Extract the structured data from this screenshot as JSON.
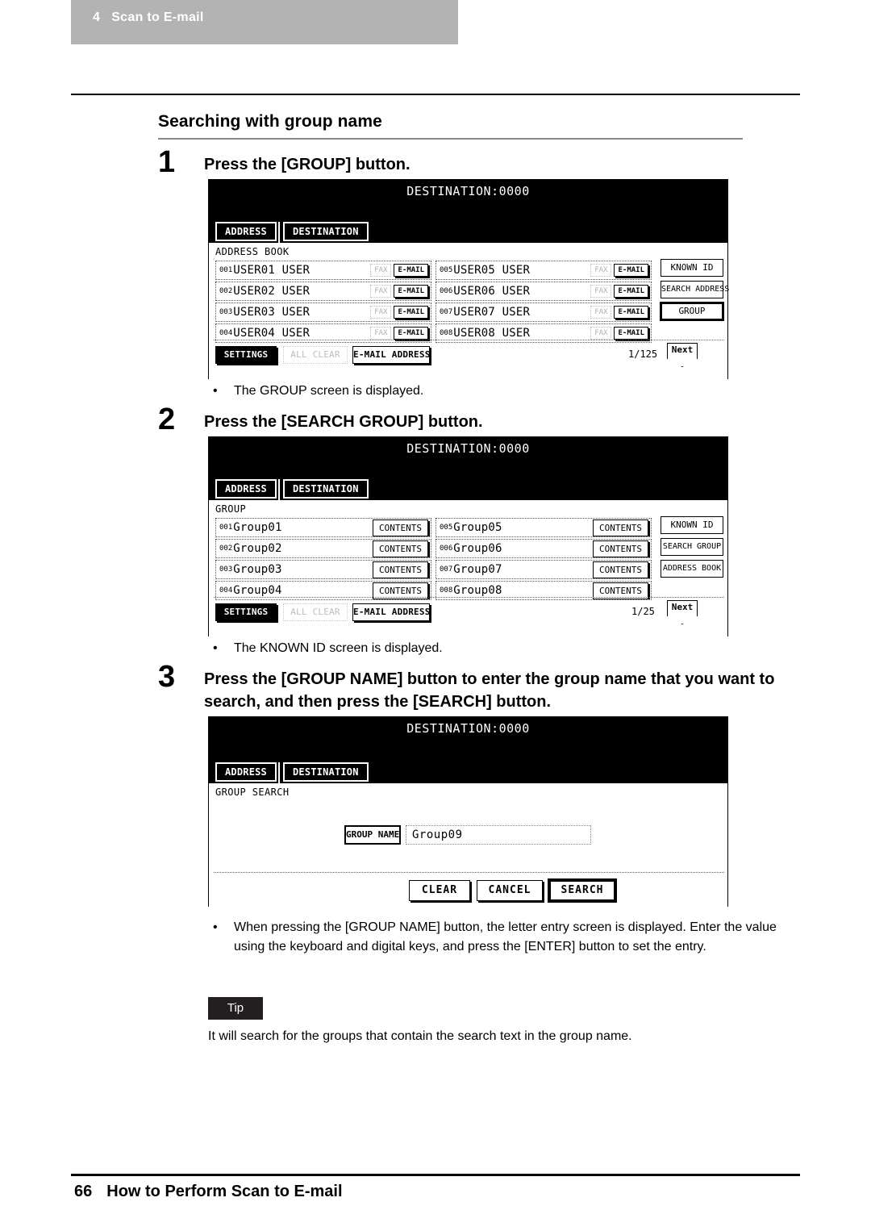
{
  "running_header": {
    "chapter_number": "4",
    "chapter_title": "Scan to E-mail"
  },
  "section": {
    "title": "Searching with group name"
  },
  "steps": [
    {
      "number": "1",
      "text": "Press the [GROUP] button."
    },
    {
      "number": "2",
      "text": "Press the [SEARCH GROUP] button."
    },
    {
      "number": "3",
      "text": "Press the [GROUP NAME] button to enter the group name that you want to search, and then press the [SEARCH] button."
    }
  ],
  "bullets": {
    "after_step1": "The GROUP screen is displayed.",
    "after_step2": "The KNOWN ID screen is displayed.",
    "after_step3": "When pressing the [GROUP NAME] button, the letter entry screen is displayed. Enter the value using the keyboard and digital keys, and press the [ENTER] button to set the entry."
  },
  "tip": {
    "label": "Tip",
    "text": "It will search for the groups that contain the search text in the group name."
  },
  "footer": {
    "page_number": "66",
    "title": "How to Perform Scan to E-mail"
  },
  "screens": {
    "address_book": {
      "destination": "DESTINATION:0000",
      "tabs": [
        {
          "label": "ADDRESS",
          "state": "selected"
        },
        {
          "label": "DESTINATION",
          "state": "normal"
        }
      ],
      "caption": "ADDRESS BOOK",
      "entries": [
        {
          "index": "001",
          "name": "USER01 USER",
          "buttons": [
            "FAX",
            "E-MAIL"
          ]
        },
        {
          "index": "002",
          "name": "USER02 USER",
          "buttons": [
            "FAX",
            "E-MAIL"
          ]
        },
        {
          "index": "003",
          "name": "USER03 USER",
          "buttons": [
            "FAX",
            "E-MAIL"
          ]
        },
        {
          "index": "004",
          "name": "USER04 USER",
          "buttons": [
            "FAX",
            "E-MAIL"
          ]
        },
        {
          "index": "005",
          "name": "USER05 USER",
          "buttons": [
            "FAX",
            "E-MAIL"
          ]
        },
        {
          "index": "006",
          "name": "USER06 USER",
          "buttons": [
            "FAX",
            "E-MAIL"
          ]
        },
        {
          "index": "007",
          "name": "USER07 USER",
          "buttons": [
            "FAX",
            "E-MAIL"
          ]
        },
        {
          "index": "008",
          "name": "USER08 USER",
          "buttons": [
            "FAX",
            "E-MAIL"
          ]
        }
      ],
      "side_buttons": [
        {
          "label": "KNOWN ID",
          "state": "normal"
        },
        {
          "label": "SEARCH ADDRESS",
          "state": "normal"
        },
        {
          "label": "GROUP",
          "state": "selected"
        }
      ],
      "bottom_buttons": [
        {
          "label": "SETTINGS",
          "state": "filled"
        },
        {
          "label": "ALL CLEAR",
          "state": "disabled"
        },
        {
          "label": "E-MAIL ADDRESS",
          "state": "outline"
        }
      ],
      "page_indicator": "1/125",
      "next_label": "Next"
    },
    "group": {
      "destination": "DESTINATION:0000",
      "tabs": [
        {
          "label": "ADDRESS",
          "state": "selected"
        },
        {
          "label": "DESTINATION",
          "state": "normal"
        }
      ],
      "caption": "GROUP",
      "entries": [
        {
          "index": "001",
          "name": "Group01",
          "buttons": [
            "CONTENTS"
          ]
        },
        {
          "index": "002",
          "name": "Group02",
          "buttons": [
            "CONTENTS"
          ]
        },
        {
          "index": "003",
          "name": "Group03",
          "buttons": [
            "CONTENTS"
          ]
        },
        {
          "index": "004",
          "name": "Group04",
          "buttons": [
            "CONTENTS"
          ]
        },
        {
          "index": "005",
          "name": "Group05",
          "buttons": [
            "CONTENTS"
          ]
        },
        {
          "index": "006",
          "name": "Group06",
          "buttons": [
            "CONTENTS"
          ]
        },
        {
          "index": "007",
          "name": "Group07",
          "buttons": [
            "CONTENTS"
          ]
        },
        {
          "index": "008",
          "name": "Group08",
          "buttons": [
            "CONTENTS"
          ]
        }
      ],
      "side_buttons": [
        {
          "label": "KNOWN ID",
          "state": "normal"
        },
        {
          "label": "SEARCH GROUP",
          "state": "normal"
        },
        {
          "label": "ADDRESS BOOK",
          "state": "normal"
        }
      ],
      "bottom_buttons": [
        {
          "label": "SETTINGS",
          "state": "filled"
        },
        {
          "label": "ALL CLEAR",
          "state": "disabled"
        },
        {
          "label": "E-MAIL ADDRESS",
          "state": "outline"
        }
      ],
      "page_indicator": "1/25",
      "next_label": "Next"
    },
    "group_search": {
      "destination": "DESTINATION:0000",
      "tabs": [
        {
          "label": "ADDRESS",
          "state": "selected"
        },
        {
          "label": "DESTINATION",
          "state": "normal"
        }
      ],
      "caption": "GROUP SEARCH",
      "field_button_label": "GROUP NAME",
      "field_value": "Group09",
      "action_buttons": [
        {
          "label": "CLEAR",
          "state": "normal"
        },
        {
          "label": "CANCEL",
          "state": "normal"
        },
        {
          "label": "SEARCH",
          "state": "selected"
        }
      ]
    }
  },
  "colors": {
    "header_band": "#b3b3b3",
    "tip_badge": "#231f20",
    "lcd_titlebar": "#000000"
  }
}
